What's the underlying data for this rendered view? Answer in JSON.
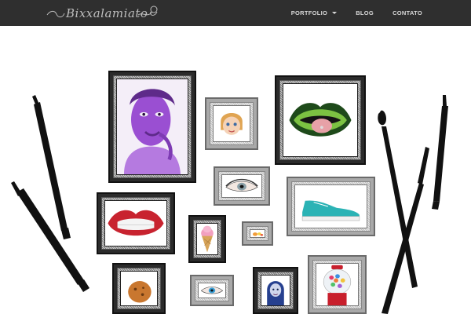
{
  "site": {
    "logo_text": "Bixxalamiato"
  },
  "nav": {
    "items": [
      {
        "label": "PORTFOLIO",
        "has_dropdown": true
      },
      {
        "label": "BLOG",
        "has_dropdown": false
      },
      {
        "label": "CONTATO",
        "has_dropdown": false
      }
    ]
  },
  "colors": {
    "topbar": "#2f2f2f",
    "nav_text": "#d8d8d8",
    "background": "#ffffff"
  },
  "gallery": {
    "frames": [
      {
        "id": "portrait-woman",
        "style": "dark",
        "art": "purple portrait"
      },
      {
        "id": "cartoon-face",
        "style": "silver",
        "art": "cartoon face"
      },
      {
        "id": "lips-tongue",
        "style": "dark",
        "art": "green lips"
      },
      {
        "id": "eye",
        "style": "silver",
        "art": "eye"
      },
      {
        "id": "sneaker",
        "style": "silver",
        "art": "teal sneaker"
      },
      {
        "id": "red-lips",
        "style": "dark",
        "art": "red lips"
      },
      {
        "id": "ice-cream",
        "style": "dark",
        "art": "ice cream cone"
      },
      {
        "id": "fruits",
        "style": "silver",
        "art": "fruits"
      },
      {
        "id": "cookie",
        "style": "dark",
        "art": "cookie"
      },
      {
        "id": "blue-eye",
        "style": "silver",
        "art": "blue eye"
      },
      {
        "id": "blue-woman",
        "style": "dark",
        "art": "blue portrait"
      },
      {
        "id": "gumball",
        "style": "silver",
        "art": "gumball machine"
      }
    ]
  },
  "decor": {
    "left_tools": [
      "marker-pen-icon",
      "marker-pen-icon"
    ],
    "right_tools": [
      "paint-brush-icon",
      "marker-pen-icon",
      "paint-brush-icon"
    ]
  }
}
